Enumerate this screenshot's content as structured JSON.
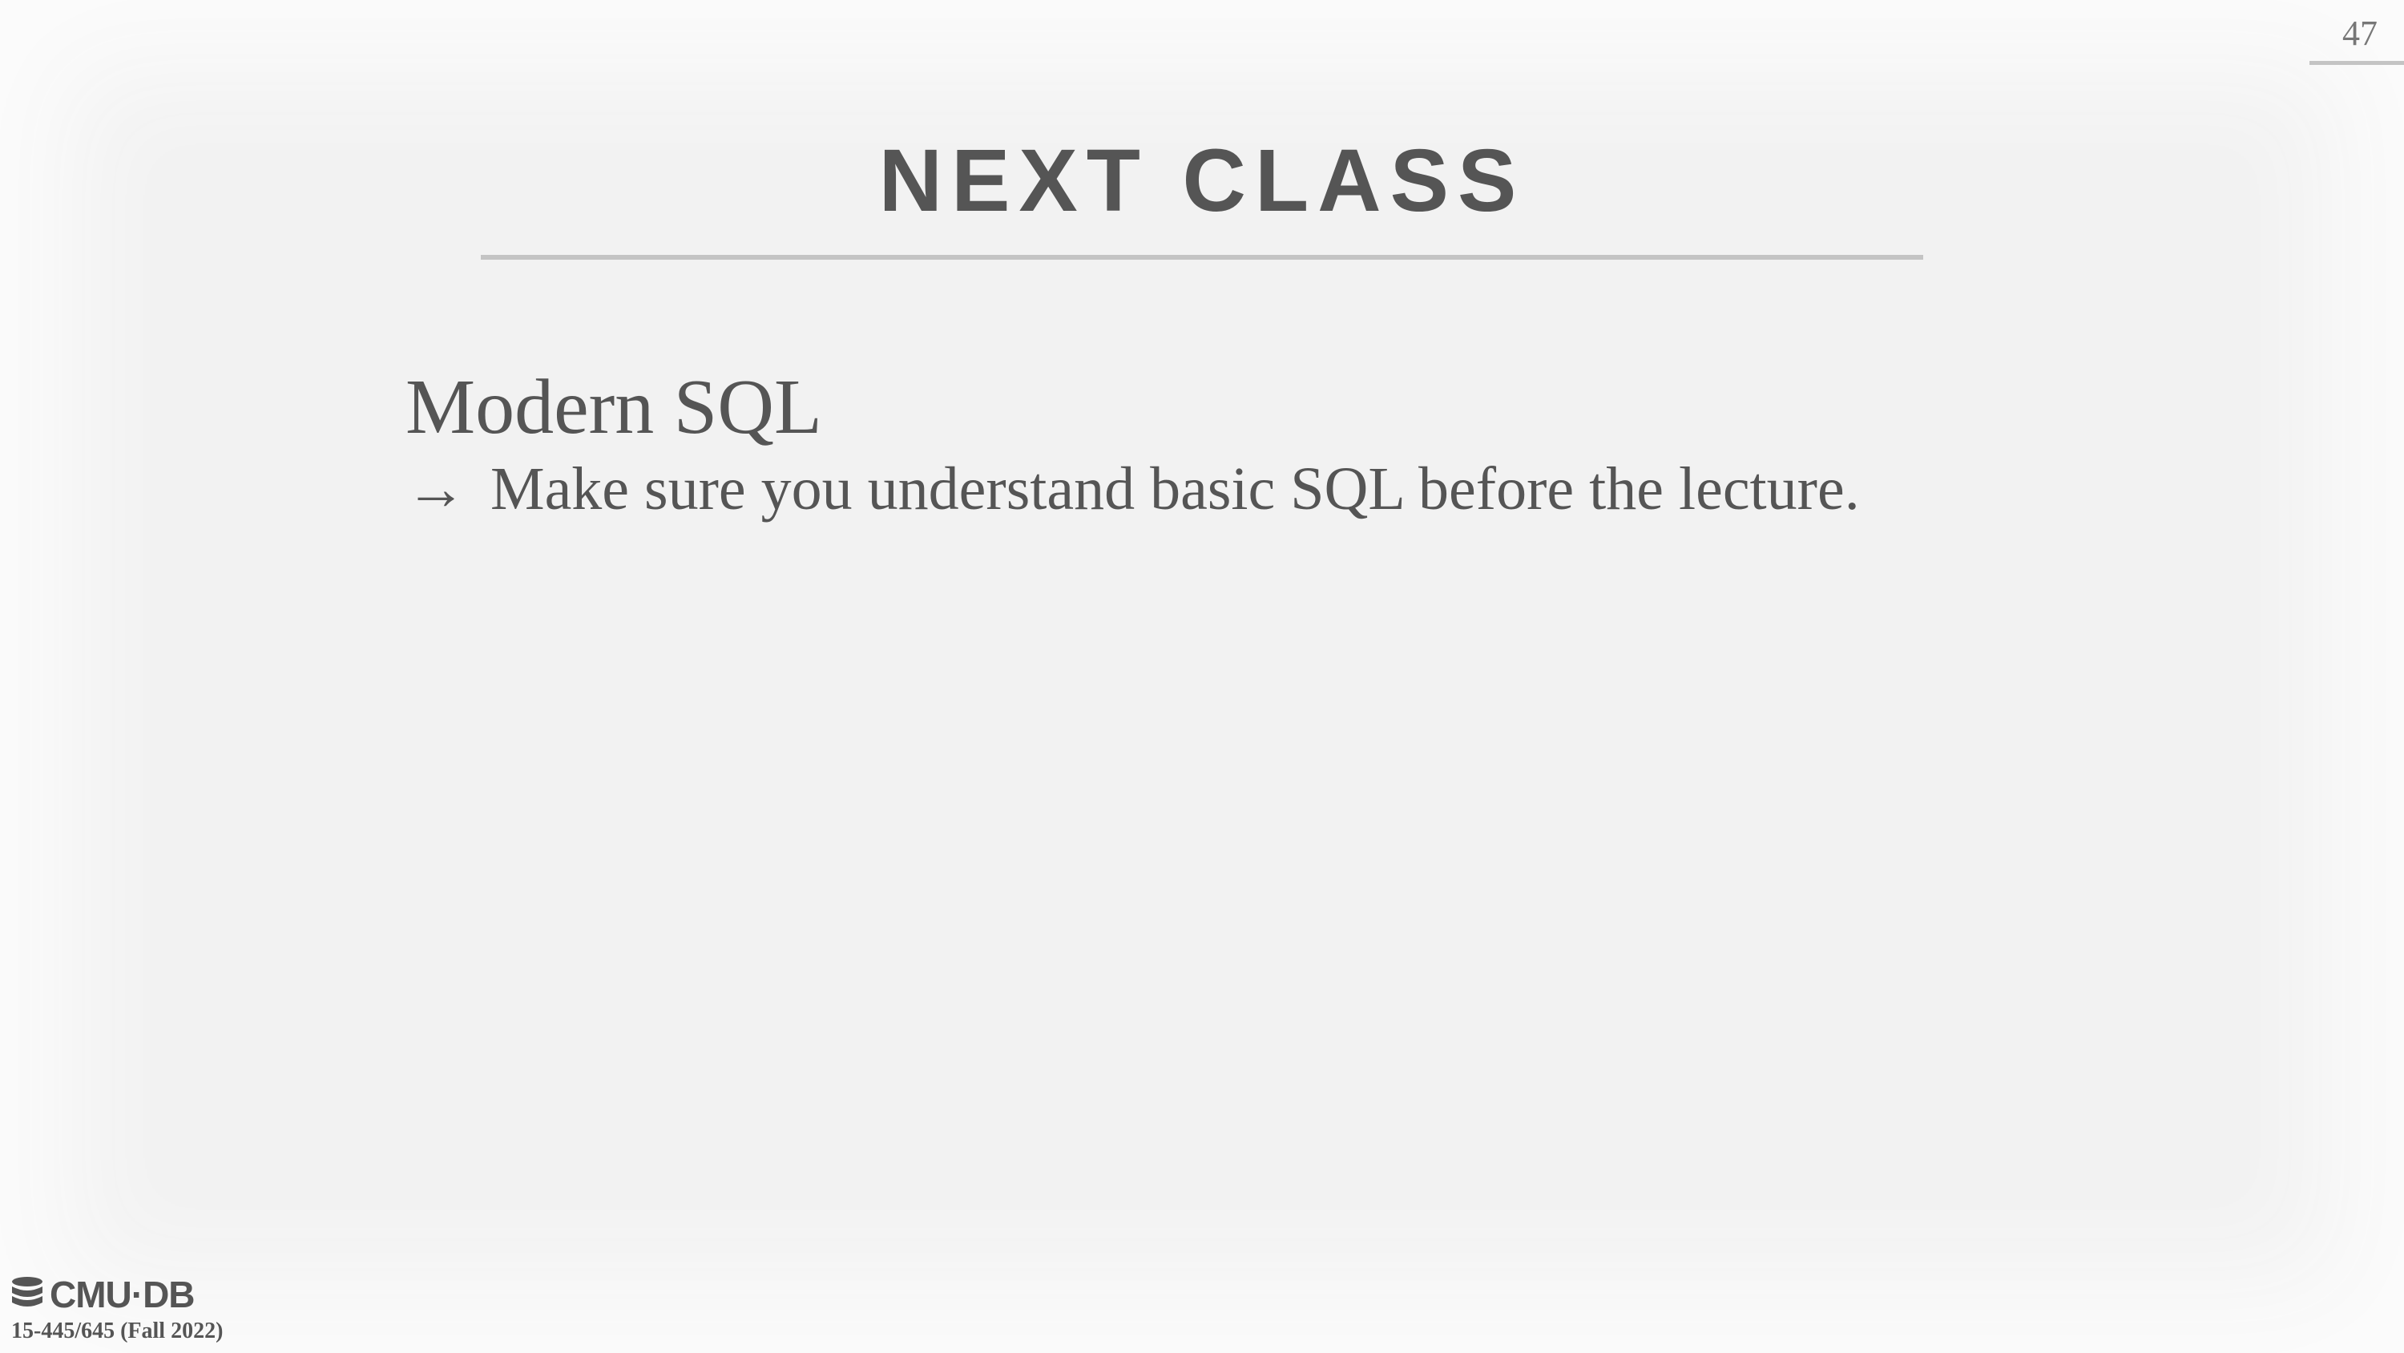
{
  "slide": {
    "title": "NEXT CLASS",
    "page_number": "47"
  },
  "content": {
    "heading": "Modern SQL",
    "sub_bullet": "Make sure you understand basic SQL before the lecture.",
    "arrow_glyph": "→"
  },
  "footer": {
    "logo_text": "CMU·DB",
    "course": "15-445/645 (Fall 2022)",
    "logo_icon": "database-icon"
  },
  "colors": {
    "background": "#f2f2f2",
    "text": "#555555",
    "rule": "#c4c4c4"
  }
}
